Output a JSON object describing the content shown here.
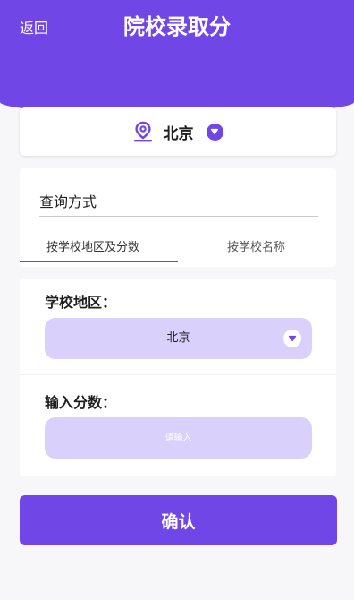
{
  "header": {
    "back_label": "返回",
    "title": "院校录取分"
  },
  "location": {
    "city": "北京",
    "pin_icon": "map-pin-icon",
    "caret_icon": "chevron-down-icon"
  },
  "query": {
    "title": "查询方式",
    "tabs": [
      {
        "label": "按学校地区及分数",
        "active": true
      },
      {
        "label": "按学校名称",
        "active": false
      }
    ]
  },
  "form": {
    "region_label": "学校地区：",
    "region_value": "北京",
    "score_label": "输入分数：",
    "score_placeholder": "请输入",
    "score_value": ""
  },
  "confirm_label": "确认",
  "colors": {
    "accent": "#7146e6",
    "field_bg": "#d9d0fb",
    "page_bg": "#f7f7f9"
  }
}
